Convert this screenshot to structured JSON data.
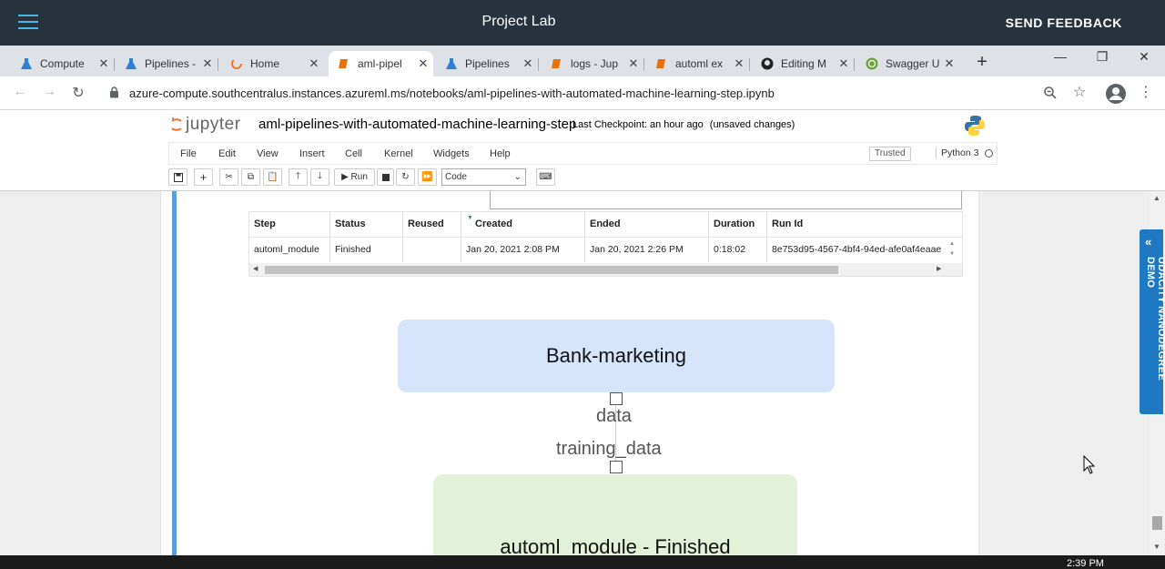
{
  "lab_bar": {
    "title": "Project Lab",
    "feedback_label": "SEND FEEDBACK"
  },
  "browser": {
    "tabs": [
      {
        "label": "Compute",
        "icon": "azure-flask-icon",
        "active": false
      },
      {
        "label": "Pipelines -",
        "icon": "azure-flask-icon",
        "active": false
      },
      {
        "label": "Home",
        "icon": "jupyter-spinner-icon",
        "active": false
      },
      {
        "label": "aml-pipel",
        "icon": "notebook-icon",
        "active": true
      },
      {
        "label": "Pipelines",
        "icon": "azure-flask-icon",
        "active": false
      },
      {
        "label": "logs - Jup",
        "icon": "notebook-icon",
        "active": false
      },
      {
        "label": "automl ex",
        "icon": "notebook-icon",
        "active": false
      },
      {
        "label": "Editing M",
        "icon": "github-icon",
        "active": false
      },
      {
        "label": "Swagger U",
        "icon": "swagger-icon",
        "active": false
      }
    ],
    "url": "azure-compute.southcentralus.instances.azureml.ms/notebooks/aml-pipelines-with-automated-machine-learning-step.ipynb"
  },
  "jupyter": {
    "logo_text": "jupyter",
    "notebook_name": "aml-pipelines-with-automated-machine-learning-step",
    "checkpoint": "Last Checkpoint: an hour ago",
    "unsaved": "(unsaved changes)",
    "menu": [
      "File",
      "Edit",
      "View",
      "Insert",
      "Cell",
      "Kernel",
      "Widgets",
      "Help"
    ],
    "trusted": "Trusted",
    "kernel": "Python 3",
    "run_label": "Run",
    "cell_type": "Code"
  },
  "runs_table": {
    "headers": [
      "Step",
      "Status",
      "Reused",
      "Created",
      "Ended",
      "Duration",
      "Run Id"
    ],
    "rows": [
      [
        "automl_module",
        "Finished",
        "",
        "Jan 20, 2021 2:08 PM",
        "Jan 20, 2021 2:26 PM",
        "0:18:02",
        "8e753d95-4567-4bf4-94ed-afe0af4eaae"
      ]
    ]
  },
  "pipeline_graph": {
    "source_node": "Bank-marketing",
    "output_port_label": "data",
    "input_port_label": "training_data",
    "step_node": "automl_module - Finished"
  },
  "udacity_tab": "UDACITY NANODEGREE DEMO",
  "taskbar": {
    "clock": "2:39 PM"
  },
  "colors": {
    "lab_bar": "#27323d",
    "source_node": "#d6e4fc",
    "step_node": "#e3f1d9",
    "cell_bar": "#42a5f5",
    "udacity": "#1f78c2"
  }
}
